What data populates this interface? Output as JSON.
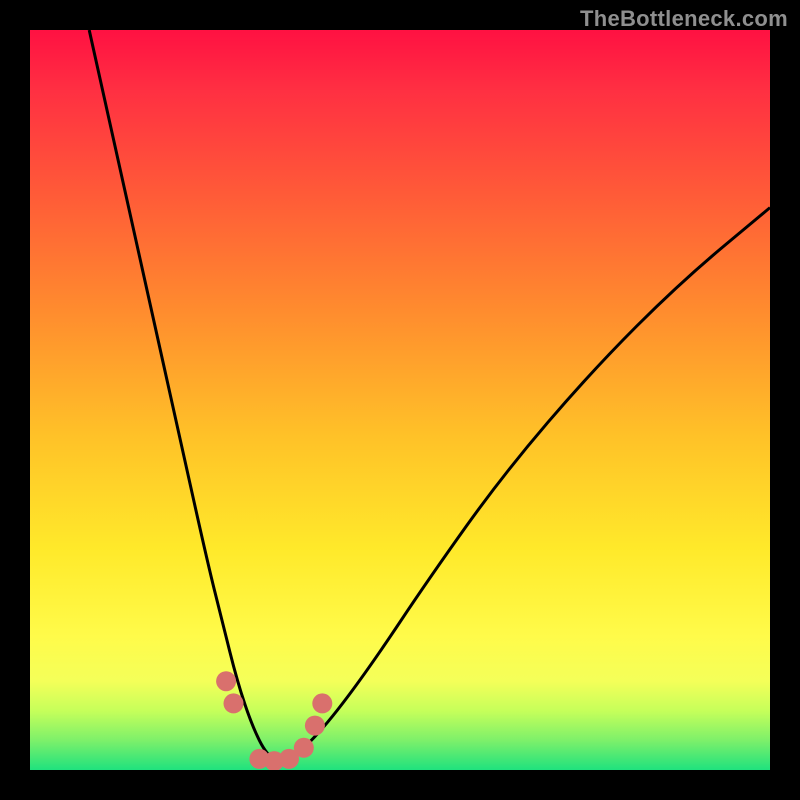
{
  "watermark": "TheBottleneck.com",
  "chart_data": {
    "type": "line",
    "title": "",
    "xlabel": "",
    "ylabel": "",
    "xlim": [
      0,
      100
    ],
    "ylim": [
      0,
      100
    ],
    "series": [
      {
        "name": "bottleneck-curve",
        "x": [
          8,
          12,
          16,
          20,
          24,
          26,
          28,
          30,
          32,
          34,
          36,
          40,
          46,
          54,
          64,
          76,
          88,
          100
        ],
        "y": [
          100,
          82,
          64,
          46,
          28,
          20,
          12,
          6,
          2,
          1,
          2,
          6,
          14,
          26,
          40,
          54,
          66,
          76
        ]
      }
    ],
    "trough_markers": {
      "name": "trough-dots",
      "x": [
        26.5,
        27.5,
        31,
        33,
        35,
        37,
        38.5,
        39.5
      ],
      "y": [
        12,
        9,
        1.5,
        1.2,
        1.5,
        3,
        6,
        9
      ]
    },
    "gradient_stops": [
      {
        "pos": 0,
        "color": "#ff1142"
      },
      {
        "pos": 22,
        "color": "#ff5a38"
      },
      {
        "pos": 55,
        "color": "#ffc228"
      },
      {
        "pos": 82,
        "color": "#fffb4a"
      },
      {
        "pos": 100,
        "color": "#1fe27e"
      }
    ],
    "marker_color": "#d9706d",
    "curve_color": "#000000"
  }
}
